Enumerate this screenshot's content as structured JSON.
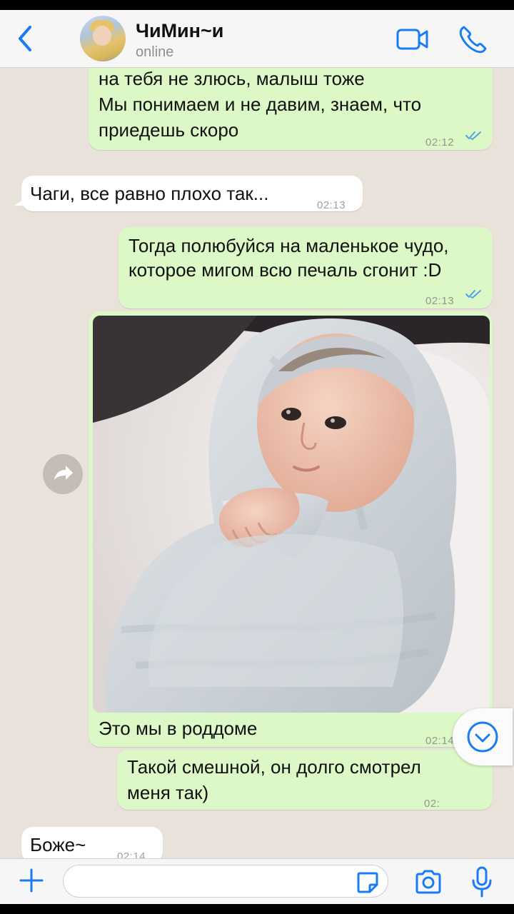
{
  "header": {
    "back_icon": "chevron-left-icon",
    "contact_name": "ЧиМин~и",
    "status": "online",
    "video_icon": "video-camera-icon",
    "call_icon": "phone-icon"
  },
  "messages": [
    {
      "direction": "outgoing",
      "lines": [
        "на тебя не злюсь, малыш тоже",
        "Мы понимаем и не давим, знаем, что",
        "приедешь скоро"
      ],
      "time": "02:12",
      "status": "read"
    },
    {
      "direction": "incoming",
      "lines": [
        "Чаги, все равно плохо так..."
      ],
      "time": "02:13"
    },
    {
      "direction": "outgoing",
      "lines": [
        "Тогда полюбуйся на маленькое чудо,",
        "которое мигом всю печаль сгонит :D"
      ],
      "time": "02:13",
      "status": "read"
    },
    {
      "direction": "outgoing",
      "type": "photo",
      "photo_subject": "newborn baby wrapped in a grey blanket",
      "caption": "Это мы в роддоме",
      "time": "02:14",
      "status": "read"
    },
    {
      "direction": "outgoing",
      "lines": [
        "Такой смешной, он долго смотрел",
        "меня так)"
      ],
      "time": "02:",
      "status": "read"
    },
    {
      "direction": "incoming",
      "lines": [
        "Боже~"
      ],
      "time": "02:14"
    }
  ],
  "controls": {
    "forward_icon": "forward-arrow-icon",
    "scroll_down_icon": "chevron-down-icon"
  },
  "input_bar": {
    "attach_icon": "plus-icon",
    "placeholder": "",
    "sticker_icon": "sticker-icon",
    "camera_icon": "camera-icon",
    "mic_icon": "microphone-icon"
  },
  "colors": {
    "accent": "#1a7cf5",
    "outgoing_bubble": "#dcf8c6",
    "incoming_bubble": "#ffffff",
    "chat_background": "#e8e2da",
    "read_ticks": "#4fa6e6"
  }
}
